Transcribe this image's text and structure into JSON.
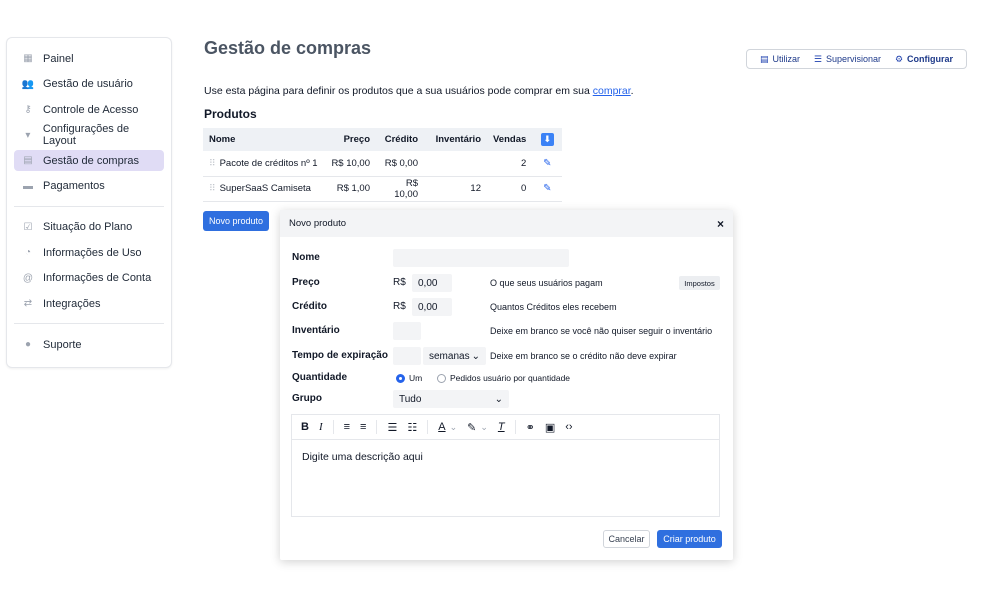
{
  "sidebar": {
    "group1": [
      {
        "label": "Painel",
        "icon": "dashboard-icon",
        "glyph": "▦"
      },
      {
        "label": "Gestão de usuário",
        "icon": "users-icon",
        "glyph": "👥"
      },
      {
        "label": "Controle de Acesso",
        "icon": "key-icon",
        "glyph": "⚷"
      },
      {
        "label": "Configurações de Layout",
        "icon": "brush-icon",
        "glyph": "▾"
      },
      {
        "label": "Gestão de compras",
        "icon": "store-icon",
        "glyph": "▤",
        "active": true
      },
      {
        "label": "Pagamentos",
        "icon": "credit-card-icon",
        "glyph": "▬"
      }
    ],
    "group2": [
      {
        "label": "Situação do Plano",
        "icon": "check-square-icon",
        "glyph": "☑"
      },
      {
        "label": "Informações de Uso",
        "icon": "pie-chart-icon",
        "glyph": "◔"
      },
      {
        "label": "Informações de Conta",
        "icon": "at-icon",
        "glyph": "@"
      },
      {
        "label": "Integrações",
        "icon": "arrows-icon",
        "glyph": "⇄"
      }
    ],
    "group3": [
      {
        "label": "Suporte",
        "icon": "help-icon",
        "glyph": "●"
      }
    ]
  },
  "header": {
    "title": "Gestão de compras",
    "modes": [
      {
        "label": "Utilizar",
        "icon": "store-icon",
        "glyph": "▤"
      },
      {
        "label": "Supervisionar",
        "icon": "sliders-icon",
        "glyph": "☰"
      },
      {
        "label": "Configurar",
        "icon": "gear-icon",
        "glyph": "⚙",
        "active": true
      }
    ]
  },
  "intro": {
    "text": "Use esta página para definir os produtos que a sua usuários pode comprar em sua ",
    "link": "comprar",
    "end": "."
  },
  "products": {
    "title": "Produtos",
    "columns": [
      "Nome",
      "Preço",
      "Crédito",
      "Inventário",
      "Vendas"
    ],
    "rows": [
      {
        "name": "Pacote de créditos nº 1",
        "price": "R$ 10,00",
        "credit": "R$ 0,00",
        "inventory": "",
        "sales": "2"
      },
      {
        "name": "SuperSaaS Camiseta",
        "price": "R$ 1,00",
        "credit": "R$ 10,00",
        "inventory": "12",
        "sales": "0"
      }
    ],
    "new_button": "Novo produto"
  },
  "modal": {
    "title": "Novo produto",
    "close": "×",
    "fields": {
      "name_label": "Nome",
      "name_value": "",
      "price_label": "Preço",
      "currency": "R$",
      "price_value": "0,00",
      "price_hint": "O que seus usuários pagam",
      "tax_button": "Impostos",
      "credit_label": "Crédito",
      "credit_value": "0,00",
      "credit_hint": "Quantos Créditos eles recebem",
      "inventory_label": "Inventário",
      "inventory_value": "",
      "inventory_hint": "Deixe em branco se você não quiser seguir o inventário",
      "expiry_label": "Tempo de expiração",
      "expiry_value": "",
      "expiry_unit": "semanas",
      "expiry_hint": "Deixe em branco se o crédito não deve expirar",
      "quantity_label": "Quantidade",
      "quantity_opt1": "Um",
      "quantity_opt2": "Pedidos usuário por quantidade",
      "group_label": "Grupo",
      "group_value": "Tudo"
    },
    "editor": {
      "placeholder": "Digite uma descrição aqui"
    },
    "cancel": "Cancelar",
    "create": "Criar produto"
  }
}
